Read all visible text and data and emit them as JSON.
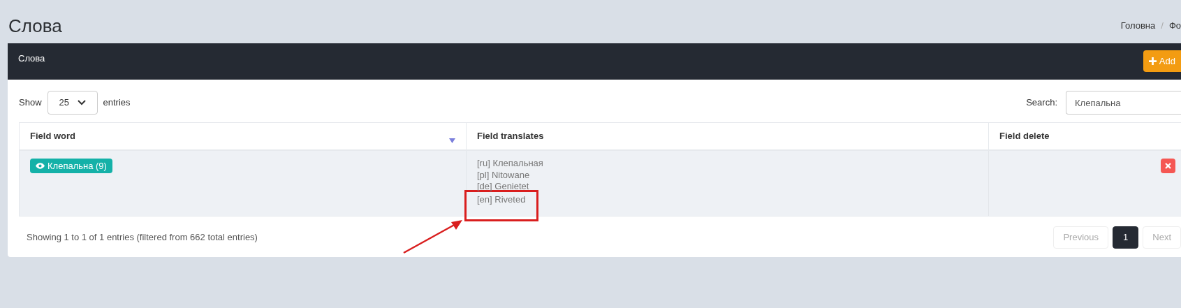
{
  "page_title": "Слова",
  "breadcrumb": [
    "Головна",
    "Фо"
  ],
  "breadcrumb_separator": "/",
  "card": {
    "title": "Слова",
    "add_button": "Add"
  },
  "length_control": {
    "label_before": "Show",
    "value": "25",
    "label_after": "entries"
  },
  "search": {
    "label": "Search:",
    "value": "Клепальна"
  },
  "table": {
    "columns": [
      {
        "label": "Field word",
        "sorted": true
      },
      {
        "label": "Field translates",
        "sorted": false
      },
      {
        "label": "Field delete",
        "sorted": false
      }
    ],
    "rows": [
      {
        "word": "Клепальна (9)",
        "translates": [
          {
            "text": "[ru] Клепальная",
            "highlighted": false
          },
          {
            "text": "[pl] Nitowane",
            "highlighted": false
          },
          {
            "text": "[de] Genietet",
            "highlighted": false
          },
          {
            "text": "[en] Riveted",
            "highlighted": true
          }
        ]
      }
    ]
  },
  "info": "Showing 1 to 1 of 1 entries (filtered from 662 total entries)",
  "pagination": [
    {
      "label": "Previous",
      "kind": "nav",
      "disabled": true,
      "selected": false
    },
    {
      "label": "1",
      "kind": "page",
      "disabled": false,
      "selected": true
    },
    {
      "label": "Next",
      "kind": "nav",
      "disabled": true,
      "selected": false
    }
  ]
}
